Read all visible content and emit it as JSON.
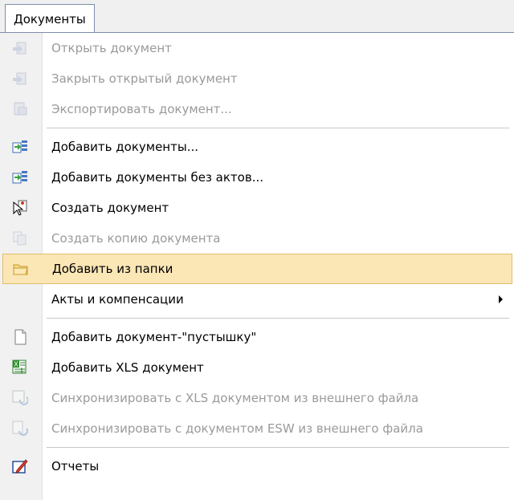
{
  "menu": {
    "title": "Документы"
  },
  "items": [
    {
      "label": "Открыть документ",
      "icon": "open-document-icon",
      "disabled": true
    },
    {
      "label": "Закрыть открытый документ",
      "icon": "close-document-icon",
      "disabled": true
    },
    {
      "label": "Экспортировать документ...",
      "icon": "export-document-icon",
      "disabled": true
    },
    {
      "label": "Добавить документы...",
      "icon": "add-documents-icon",
      "disabled": false
    },
    {
      "label": "Добавить документы без актов...",
      "icon": "add-documents-no-acts-icon",
      "disabled": false
    },
    {
      "label": "Создать документ",
      "icon": "create-document-icon",
      "disabled": false
    },
    {
      "label": "Создать копию документа",
      "icon": "copy-document-icon",
      "disabled": true
    },
    {
      "label": "Добавить из папки",
      "icon": "folder-icon",
      "disabled": false,
      "highlighted": true
    },
    {
      "label": "Акты и компенсации",
      "icon": "",
      "disabled": false,
      "submenu": true
    },
    {
      "label": "Добавить документ-\"пустышку\"",
      "icon": "blank-document-icon",
      "disabled": false
    },
    {
      "label": "Добавить XLS документ",
      "icon": "xls-document-icon",
      "disabled": false
    },
    {
      "label": "Синхронизировать с XLS документом из внешнего файла",
      "icon": "sync-xls-icon",
      "disabled": true
    },
    {
      "label": "Синхронизировать с документом ESW из внешнего файла",
      "icon": "sync-esw-icon",
      "disabled": true
    },
    {
      "label": "Отчеты",
      "icon": "reports-icon",
      "disabled": false
    }
  ],
  "colors": {
    "highlight": "#fbe6b6",
    "highlight_border": "#e2bd6b",
    "disabled_text": "#9a9a9a"
  }
}
